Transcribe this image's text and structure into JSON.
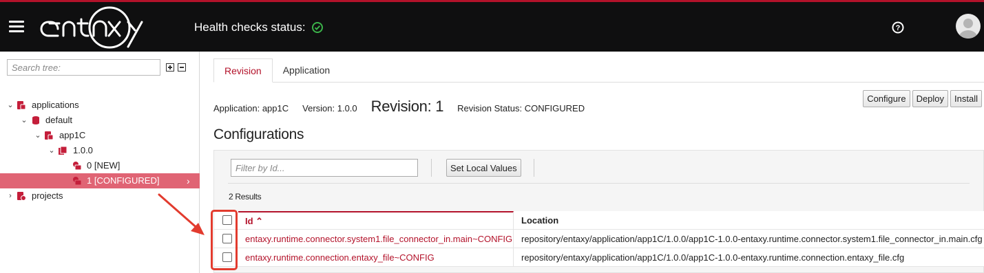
{
  "navbar": {
    "menu_icon": "hamburger-icon",
    "logo_text": "entaxy",
    "health_label": "Health checks status:",
    "health_icon": "check-circle-icon",
    "health_color": "#3bb44a",
    "help_icon": "question-circle-icon",
    "avatar_icon": "user-avatar-icon"
  },
  "sidebar": {
    "search_placeholder": "Search tree:",
    "expand_all_icon": "plus-square-icon",
    "collapse_all_icon": "minus-square-icon",
    "tree": [
      {
        "label": "applications",
        "toggle": "⌄",
        "icon": "applications-icon"
      },
      {
        "label": "default",
        "toggle": "⌄",
        "icon": "database-icon"
      },
      {
        "label": "app1C",
        "toggle": "⌄",
        "icon": "application-icon"
      },
      {
        "label": "1.0.0",
        "toggle": "⌄",
        "icon": "version-icon"
      },
      {
        "label": "0 [NEW]",
        "toggle": "",
        "icon": "revision-icon"
      },
      {
        "label": "1 [CONFIGURED]",
        "toggle": "",
        "icon": "revision-icon",
        "selected_arrow": "›"
      },
      {
        "label": "projects",
        "toggle": "›",
        "icon": "projects-icon"
      }
    ]
  },
  "tabs": [
    {
      "label": "Revision"
    },
    {
      "label": "Application"
    }
  ],
  "info": {
    "application": "Application: app1C",
    "version": "Version: 1.0.0",
    "revision": "Revision: 1",
    "status": "Revision Status: CONFIGURED"
  },
  "actions": {
    "configure": "Configure",
    "deploy": "Deploy",
    "install": "Install"
  },
  "configurations": {
    "title": "Configurations",
    "filter_placeholder": "Filter by Id...",
    "set_local_values": "Set Local Values",
    "results": "2 Results",
    "columns": {
      "id": "Id ⌃",
      "location": "Location"
    },
    "rows": [
      {
        "id": "entaxy.runtime.connector.system1.file_connector_in.main~CONFIG",
        "location": "repository/entaxy/application/app1C/1.0.0/app1C-1.0.0-entaxy.runtime.connector.system1.file_connector_in.main.cfg"
      },
      {
        "id": "entaxy.runtime.connection.entaxy_file~CONFIG",
        "location": "repository/entaxy/application/app1C/1.0.0/app1C-1.0.0-entaxy.runtime.connection.entaxy_file.cfg"
      }
    ]
  },
  "colors": {
    "accent": "#b3122a",
    "selected_tree": "#e06474",
    "annotation": "#e23b2e"
  }
}
